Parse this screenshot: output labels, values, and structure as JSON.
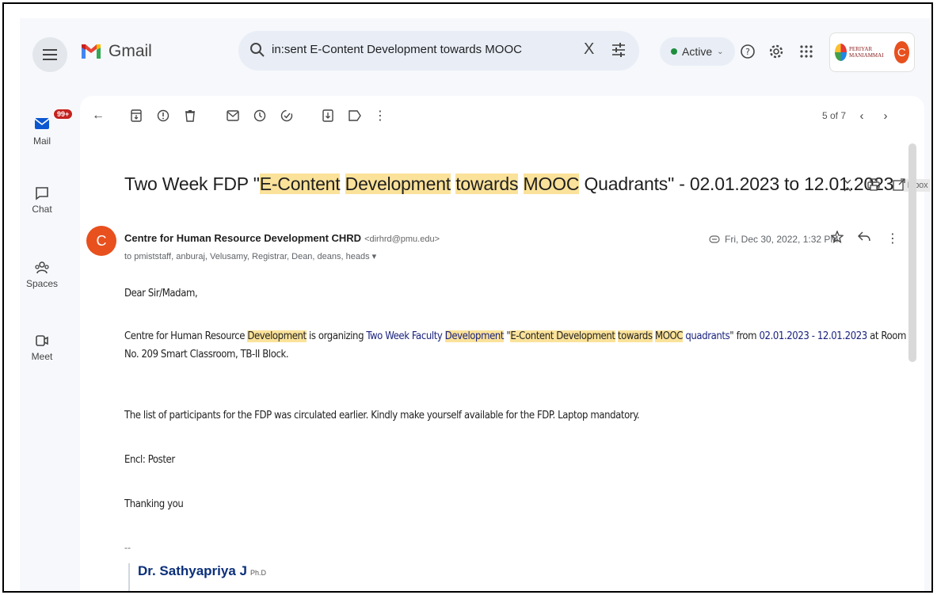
{
  "header": {
    "logo_text": "Gmail",
    "search_value": "in:sent E-Content Development towards MOOC",
    "clear_symbol": "X",
    "status": "Active",
    "status_color": "#1e8e3e",
    "account_org": "PERIYAR MANIAMMAI",
    "account_initial": "C"
  },
  "rail": {
    "mail_label": "Mail",
    "mail_badge": "99+",
    "chat_label": "Chat",
    "spaces_label": "Spaces",
    "meet_label": "Meet"
  },
  "toolbar": {
    "pager": "5 of 7"
  },
  "email": {
    "subject_pre": "Two Week FDP \"",
    "subject_h1": "E-Content",
    "subject_h2": "Development",
    "subject_h3": "towards",
    "subject_h4": "MOOC",
    "subject_post": " Quadrants\" - 02.01.2023 to 12.01.2023",
    "label_chip": "Inbox ×",
    "sender_initial": "C",
    "sender_name": "Centre for Human Resource Development CHRD",
    "sender_email": "<dirhrd@pmu.edu>",
    "recipients": "to pmiststaff, anburaj, Velusamy, Registrar, Dean, deans, heads ▾",
    "date": "Fri, Dec 30, 2022, 1:32 PM",
    "greeting": "Dear Sir/Madam,",
    "p1_a": "Centre for Human Resource ",
    "p1_hl1": "Development",
    "p1_b": " is organizing ",
    "p1_link1": "Two Week Faculty ",
    "p1_hl2": "Development",
    "p1_c": " \"",
    "p1_hl3": "E-Content Development",
    "p1_sp1": " ",
    "p1_hl4": "towards",
    "p1_sp2": " ",
    "p1_hl5": "MOOC",
    "p1_link2": " quadrants",
    "p1_d": "\" from ",
    "p1_dates": "02.01.2023 - 12.01.2023",
    "p1_e": " at Room No. 209 Smart Classroom, TB-II Block.",
    "p2": "The list of participants for the FDP was circulated earlier. Kindly make yourself available for the FDP. Laptop mandatory.",
    "p3": "Encl: Poster",
    "p4": "Thanking you",
    "sig_dash": "--",
    "sig_name": "Dr. Sathyapriya J",
    "sig_degree": "Ph.D"
  }
}
